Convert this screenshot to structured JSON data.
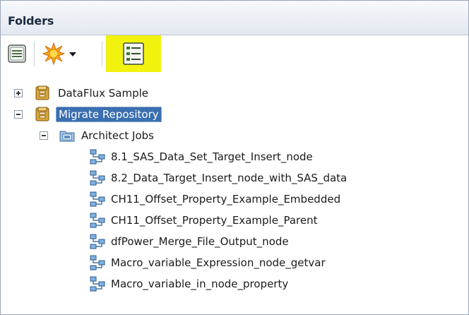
{
  "panel": {
    "title": "Folders"
  },
  "toolbar": {
    "buttons": [
      {
        "name": "properties",
        "icon": "properties-icon"
      },
      {
        "name": "new",
        "icon": "new-star-icon",
        "has_dropdown": true
      },
      {
        "name": "details-view",
        "icon": "details-list-icon",
        "highlighted": true
      }
    ],
    "highlight_color": "#f2f20f"
  },
  "tree": {
    "items": [
      {
        "label": "DataFlux Sample",
        "type": "repository",
        "expander": "plus",
        "selected": false
      },
      {
        "label": "Migrate Repository",
        "type": "repository",
        "expander": "minus",
        "selected": true
      },
      {
        "label": "Architect Jobs",
        "type": "folder",
        "expander": "minus",
        "selected": false
      },
      {
        "label": "8.1_SAS_Data_Set_Target_Insert_node",
        "type": "job"
      },
      {
        "label": "8.2_Data_Target_Insert_node_with_SAS_data",
        "type": "job"
      },
      {
        "label": "CH11_Offset_Property_Example_Embedded",
        "type": "job"
      },
      {
        "label": "CH11_Offset_Property_Example_Parent",
        "type": "job"
      },
      {
        "label": "dfPower_Merge_File_Output_node",
        "type": "job"
      },
      {
        "label": "Macro_variable_Expression_node_getvar",
        "type": "job"
      },
      {
        "label": "Macro_variable_in_node_property",
        "type": "job"
      }
    ]
  },
  "colors": {
    "selection": "#3a6fb0",
    "header_gradient_top": "#f6f8fb",
    "header_gradient_bottom": "#e3e8f0"
  }
}
